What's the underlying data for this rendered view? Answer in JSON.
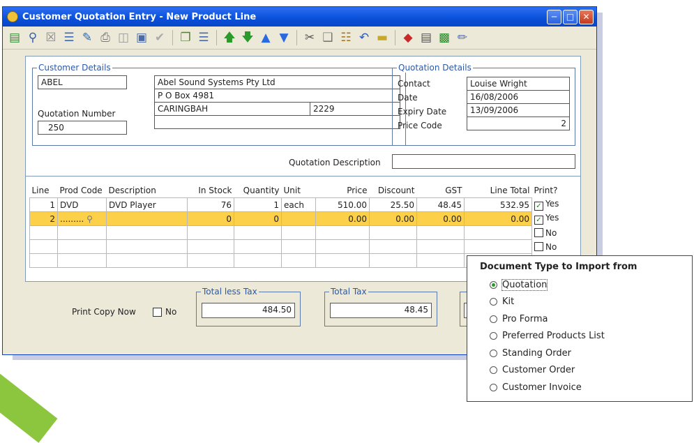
{
  "window": {
    "title": "Customer Quotation Entry - New Product Line"
  },
  "toolbar": {
    "icons": [
      "accept-icon",
      "search-icon",
      "clear-icon",
      "list-icon",
      "edit-icon",
      "print-icon",
      "save-icon",
      "preview-icon",
      "check-icon",
      "copy-icon",
      "lines-icon",
      "arrow-up-icon",
      "arrow-down-icon",
      "circle-up-icon",
      "circle-down-icon",
      "cut-icon",
      "paste-icon",
      "clipboard-icon",
      "undo-icon",
      "card-icon",
      "diamond-icon",
      "sort-icon",
      "sort-alpha-icon",
      "notes-icon"
    ]
  },
  "customer": {
    "group_label": "Customer Details",
    "code": "ABEL",
    "name": "Abel Sound Systems Pty Ltd",
    "address1": "P O Box 4981",
    "suburb": "CARINGBAH",
    "postcode": "2229",
    "address3": "",
    "quote_number_label": "Quotation Number",
    "quote_number": "250"
  },
  "quotation": {
    "group_label": "Quotation Details",
    "contact_label": "Contact",
    "contact": "Louise Wright",
    "date_label": "Date",
    "date": "16/08/2006",
    "expiry_label": "Expiry Date",
    "expiry": "13/09/2006",
    "price_code_label": "Price Code",
    "price_code": "2",
    "description_label": "Quotation Description",
    "description": ""
  },
  "lines": {
    "headers": [
      "Line",
      "Prod Code",
      "Description",
      "In Stock",
      "Quantity",
      "Unit",
      "Price",
      "Discount",
      "GST",
      "Line Total",
      "Print?"
    ],
    "rows": [
      {
        "line": "1",
        "code": "DVD",
        "desc": "DVD Player",
        "stock": "76",
        "qty": "1",
        "unit": "each",
        "price": "510.00",
        "discount": "25.50",
        "gst": "48.45",
        "total": "532.95",
        "print": "Yes",
        "checked": true
      },
      {
        "line": "2",
        "code": ".........",
        "desc": "",
        "stock": "0",
        "qty": "0",
        "unit": "",
        "price": "0.00",
        "discount": "0.00",
        "gst": "0.00",
        "total": "0.00",
        "print": "Yes",
        "checked": true
      },
      {
        "line": "",
        "code": "",
        "desc": "",
        "stock": "",
        "qty": "",
        "unit": "",
        "price": "",
        "discount": "",
        "gst": "",
        "total": "",
        "print": "No",
        "checked": false
      },
      {
        "line": "",
        "code": "",
        "desc": "",
        "stock": "",
        "qty": "",
        "unit": "",
        "price": "",
        "discount": "",
        "gst": "",
        "total": "",
        "print": "No",
        "checked": false
      }
    ]
  },
  "totals": {
    "print_copy_label": "Print Copy Now",
    "print_copy_value": "No",
    "less_tax_label": "Total less Tax",
    "less_tax": "484.50",
    "tax_label": "Total Tax",
    "tax": "48.45"
  },
  "popup": {
    "title": "Document Type to Import from",
    "options": [
      "Quotation",
      "Kit",
      "Pro Forma",
      "Preferred Products List",
      "Standing Order",
      "Customer Order",
      "Customer Invoice"
    ],
    "selected": "Quotation"
  },
  "colors": {
    "title_bar": "#0a4fd9",
    "selected_row": "#fdd04a",
    "group_border": "#5a79a8",
    "accent_green": "#8cc63f"
  }
}
